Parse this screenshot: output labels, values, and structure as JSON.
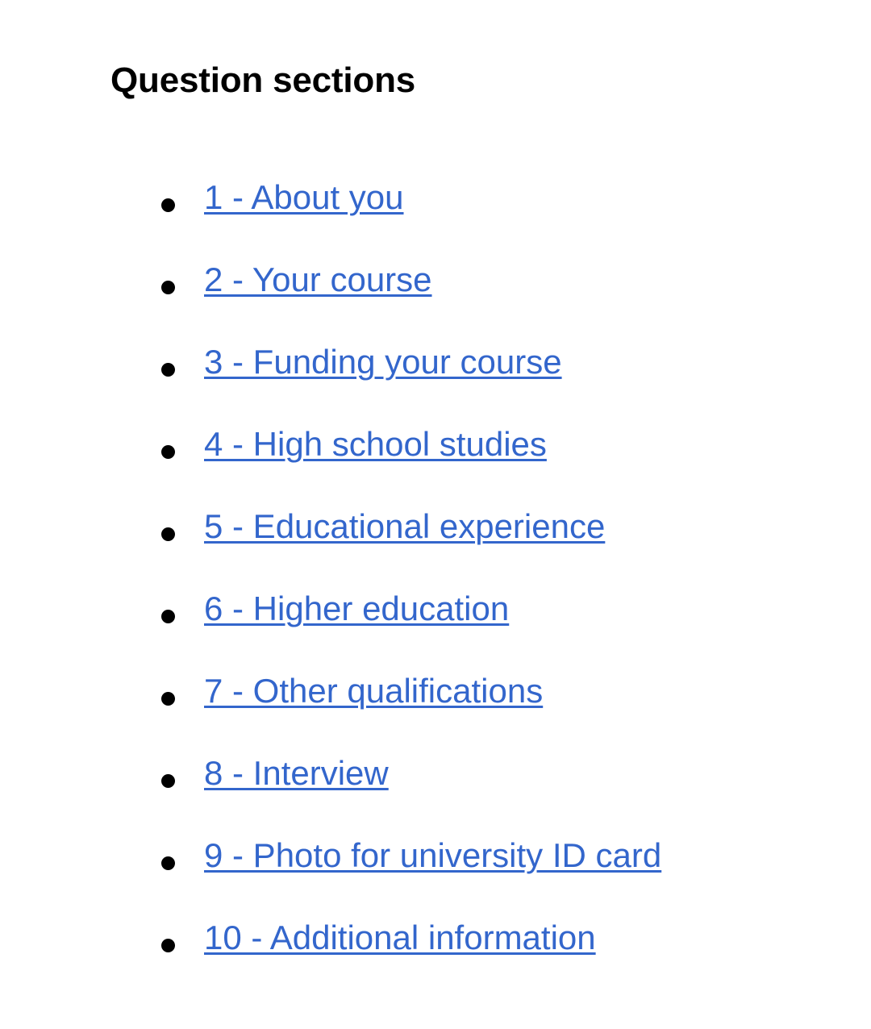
{
  "page": {
    "title": "Question sections",
    "background_color": "#ffffff",
    "heading_color": "#000000",
    "link_color": "#3366cc",
    "bullet_color": "#000000"
  },
  "bullet_icon_name": "bullet-dot-icon",
  "sections": [
    {
      "label": "1 - About you"
    },
    {
      "label": "2 - Your course"
    },
    {
      "label": "3 - Funding your course"
    },
    {
      "label": "4 - High school studies"
    },
    {
      "label": "5 - Educational experience"
    },
    {
      "label": "6 - Higher education"
    },
    {
      "label": "7 - Other qualifications"
    },
    {
      "label": "8 - Interview"
    },
    {
      "label": "9 - Photo for university ID card"
    },
    {
      "label": "10 - Additional information"
    }
  ]
}
